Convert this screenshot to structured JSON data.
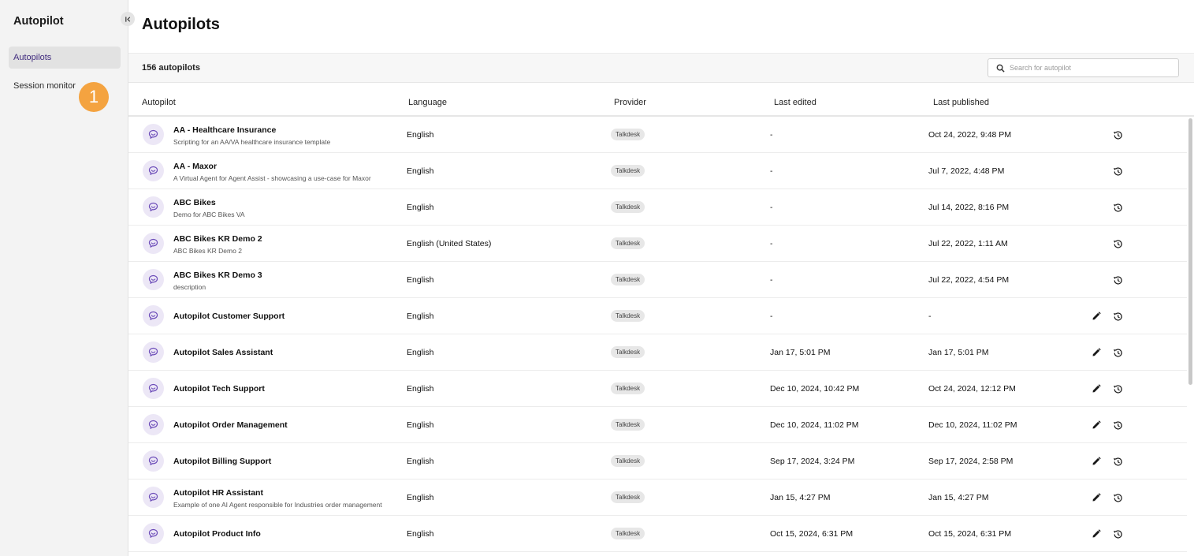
{
  "sidebar": {
    "title": "Autopilot",
    "items": [
      {
        "label": "Autopilots"
      },
      {
        "label": "Session monitor"
      }
    ],
    "step_badge": "1"
  },
  "main": {
    "title": "Autopilots",
    "count": "156 autopilots",
    "search": {
      "placeholder": "Search for autopilot",
      "value": ""
    },
    "columns": [
      "Autopilot",
      "Language",
      "Provider",
      "Last edited",
      "Last published"
    ],
    "rows": [
      {
        "name": "AA - Healthcare Insurance",
        "desc": "Scripting for an AA/VA healthcare insurance template",
        "language": "English",
        "provider": "Talkdesk",
        "edited": "-",
        "published": "Oct 24, 2022, 9:48 PM",
        "editable": false
      },
      {
        "name": "AA - Maxor",
        "desc": "A Virtual Agent for Agent Assist - showcasing a use-case for Maxor",
        "language": "English",
        "provider": "Talkdesk",
        "edited": "-",
        "published": "Jul 7, 2022, 4:48 PM",
        "editable": false
      },
      {
        "name": "ABC Bikes",
        "desc": "Demo for ABC Bikes VA",
        "language": "English",
        "provider": "Talkdesk",
        "edited": "-",
        "published": "Jul 14, 2022, 8:16 PM",
        "editable": false
      },
      {
        "name": "ABC Bikes KR Demo 2",
        "desc": "ABC Bikes KR Demo 2",
        "language": "English (United States)",
        "provider": "Talkdesk",
        "edited": "-",
        "published": "Jul 22, 2022, 1:11 AM",
        "editable": false
      },
      {
        "name": "ABC Bikes KR Demo 3",
        "desc": "description",
        "language": "English",
        "provider": "Talkdesk",
        "edited": "-",
        "published": "Jul 22, 2022, 4:54 PM",
        "editable": false
      },
      {
        "name": "Autopilot Customer Support",
        "desc": "",
        "language": "English",
        "provider": "Talkdesk",
        "edited": "-",
        "published": "-",
        "editable": true
      },
      {
        "name": "Autopilot Sales Assistant",
        "desc": "",
        "language": "English",
        "provider": "Talkdesk",
        "edited": "Jan 17, 5:01 PM",
        "published": "Jan 17, 5:01 PM",
        "editable": true
      },
      {
        "name": "Autopilot Tech Support",
        "desc": "",
        "language": "English",
        "provider": "Talkdesk",
        "edited": "Dec 10, 2024, 10:42 PM",
        "published": "Oct 24, 2024, 12:12 PM",
        "editable": true
      },
      {
        "name": "Autopilot Order Management",
        "desc": "",
        "language": "English",
        "provider": "Talkdesk",
        "edited": "Dec 10, 2024, 11:02 PM",
        "published": "Dec 10, 2024, 11:02 PM",
        "editable": true
      },
      {
        "name": "Autopilot Billing Support",
        "desc": "",
        "language": "English",
        "provider": "Talkdesk",
        "edited": "Sep 17, 2024, 3:24 PM",
        "published": "Sep 17, 2024, 2:58 PM",
        "editable": true
      },
      {
        "name": "Autopilot HR Assistant",
        "desc": "Example of one AI Agent responsible for Industries order management",
        "language": "English",
        "provider": "Talkdesk",
        "edited": "Jan 15, 4:27 PM",
        "published": "Jan 15, 4:27 PM",
        "editable": true
      },
      {
        "name": "Autopilot Product Info",
        "desc": "",
        "language": "English",
        "provider": "Talkdesk",
        "edited": "Oct 15, 2024, 6:31 PM",
        "published": "Oct 15, 2024, 6:31 PM",
        "editable": true
      }
    ]
  },
  "icons": {
    "collapse": "collapse-sidebar-icon",
    "search": "search-icon",
    "avatar": "chat-bubble-icon",
    "edit": "pencil-icon",
    "history": "history-icon"
  },
  "colors": {
    "accent": "#3f2a7d",
    "avatar_bg": "#ece7f6",
    "badge": "#f4a340",
    "sidebar_bg": "#f3f3f3",
    "tag_bg": "#e7e7e7"
  }
}
